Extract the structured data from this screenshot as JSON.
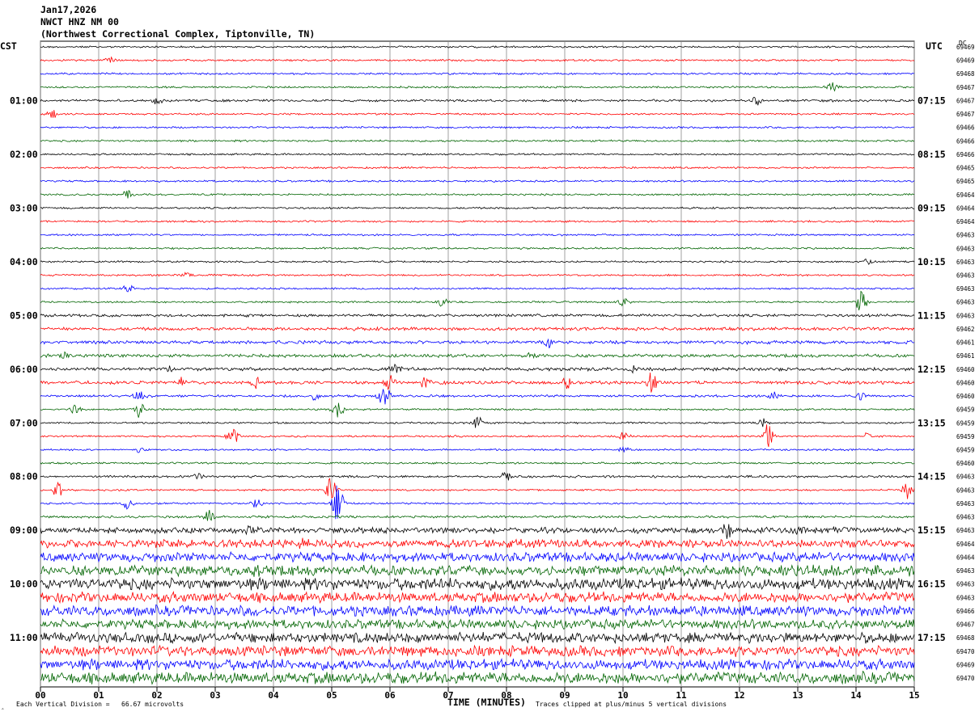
{
  "header": {
    "date": "Jan17,2026",
    "channel": "NWCT HNZ NM 00",
    "station": "(Northwest Correctional Complex, Tiptonville, TN)"
  },
  "left_tz": "CST",
  "right_tz": "UTC",
  "dc_label": "DC",
  "x_axis_label": "TIME (MINUTES)",
  "footer_left": "Each Vertical Division =   66.67 microvolts",
  "footer_right": "Traces clipped at plus/minus 5 vertical divisions",
  "colors": {
    "trace_cycle": [
      "#000000",
      "#ff0000",
      "#0000ff",
      "#006400"
    ]
  },
  "chart_data": {
    "type": "line",
    "title": "NWCT HNZ NM 00",
    "xlabel": "TIME (MINUTES)",
    "ylabel": "",
    "xlim": [
      0,
      15
    ],
    "x_ticks": [
      "00",
      "01",
      "02",
      "03",
      "04",
      "05",
      "06",
      "07",
      "08",
      "09",
      "10",
      "11",
      "12",
      "13",
      "14",
      "15"
    ],
    "grid": true,
    "rows_per_hour": 4,
    "left_hour_labels": [
      "01:00",
      "02:00",
      "03:00",
      "04:00",
      "05:00",
      "06:00",
      "07:00",
      "08:00",
      "09:00",
      "10:00",
      "11:00"
    ],
    "right_hour_labels": [
      "07:15",
      "08:15",
      "09:15",
      "10:15",
      "11:15",
      "12:15",
      "13:15",
      "14:15",
      "15:15",
      "16:15",
      "17:15"
    ],
    "dc_offsets": [
      69469,
      69469,
      69468,
      69467,
      69467,
      69467,
      69466,
      69466,
      69466,
      69465,
      69465,
      69464,
      69464,
      69464,
      69463,
      69463,
      69463,
      69463,
      69463,
      69463,
      69463,
      69462,
      69461,
      69461,
      69460,
      69460,
      69460,
      69459,
      69459,
      69459,
      69459,
      69460,
      69463,
      69463,
      69463,
      69463,
      69463,
      69464,
      69464,
      69463,
      69463,
      69463,
      69466,
      69467,
      69468,
      69470,
      69469,
      69470
    ],
    "noise_level": [
      0.08,
      0.08,
      0.08,
      0.08,
      0.1,
      0.08,
      0.08,
      0.08,
      0.08,
      0.08,
      0.08,
      0.08,
      0.08,
      0.08,
      0.08,
      0.08,
      0.08,
      0.08,
      0.08,
      0.08,
      0.12,
      0.14,
      0.14,
      0.14,
      0.14,
      0.14,
      0.1,
      0.08,
      0.08,
      0.08,
      0.08,
      0.08,
      0.1,
      0.08,
      0.08,
      0.1,
      0.25,
      0.35,
      0.4,
      0.45,
      0.5,
      0.45,
      0.45,
      0.4,
      0.45,
      0.45,
      0.45,
      0.5
    ],
    "events": [
      {
        "row": 1,
        "t": 1.2,
        "amp": 0.25
      },
      {
        "row": 4,
        "t": 12.3,
        "amp": 0.35
      },
      {
        "row": 4,
        "t": 2.0,
        "amp": 0.3
      },
      {
        "row": 5,
        "t": 0.2,
        "amp": 0.4
      },
      {
        "row": 3,
        "t": 13.6,
        "amp": 0.35
      },
      {
        "row": 11,
        "t": 1.5,
        "amp": 0.3
      },
      {
        "row": 16,
        "t": 14.2,
        "amp": 0.3
      },
      {
        "row": 17,
        "t": 2.5,
        "amp": 0.25
      },
      {
        "row": 18,
        "t": 1.5,
        "amp": 0.3
      },
      {
        "row": 19,
        "t": 14.1,
        "amp": 1.1
      },
      {
        "row": 19,
        "t": 6.9,
        "amp": 0.3
      },
      {
        "row": 19,
        "t": 10.0,
        "amp": 0.3
      },
      {
        "row": 22,
        "t": 8.7,
        "amp": 0.55
      },
      {
        "row": 23,
        "t": 8.4,
        "amp": 0.4
      },
      {
        "row": 23,
        "t": 0.4,
        "amp": 0.3
      },
      {
        "row": 24,
        "t": 6.1,
        "amp": 0.5
      },
      {
        "row": 24,
        "t": 10.2,
        "amp": 0.35
      },
      {
        "row": 24,
        "t": 2.2,
        "amp": 0.3
      },
      {
        "row": 25,
        "t": 2.4,
        "amp": 0.5
      },
      {
        "row": 25,
        "t": 3.7,
        "amp": 0.4
      },
      {
        "row": 25,
        "t": 6.0,
        "amp": 0.7
      },
      {
        "row": 25,
        "t": 9.0,
        "amp": 0.6
      },
      {
        "row": 25,
        "t": 10.5,
        "amp": 0.8
      },
      {
        "row": 25,
        "t": 6.6,
        "amp": 0.4
      },
      {
        "row": 26,
        "t": 1.7,
        "amp": 0.5
      },
      {
        "row": 26,
        "t": 5.9,
        "amp": 0.9
      },
      {
        "row": 26,
        "t": 4.7,
        "amp": 0.4
      },
      {
        "row": 26,
        "t": 12.6,
        "amp": 0.4
      },
      {
        "row": 26,
        "t": 14.1,
        "amp": 0.35
      },
      {
        "row": 27,
        "t": 1.7,
        "amp": 0.6
      },
      {
        "row": 27,
        "t": 5.1,
        "amp": 0.7
      },
      {
        "row": 27,
        "t": 0.6,
        "amp": 0.3
      },
      {
        "row": 28,
        "t": 7.5,
        "amp": 0.5
      },
      {
        "row": 28,
        "t": 12.4,
        "amp": 0.35
      },
      {
        "row": 29,
        "t": 3.3,
        "amp": 0.8
      },
      {
        "row": 29,
        "t": 12.5,
        "amp": 1.0
      },
      {
        "row": 29,
        "t": 10.0,
        "amp": 0.35
      },
      {
        "row": 29,
        "t": 14.2,
        "amp": 0.3
      },
      {
        "row": 30,
        "t": 1.7,
        "amp": 0.25
      },
      {
        "row": 30,
        "t": 10.0,
        "amp": 0.25
      },
      {
        "row": 32,
        "t": 2.7,
        "amp": 0.35
      },
      {
        "row": 32,
        "t": 8.0,
        "amp": 0.35
      },
      {
        "row": 33,
        "t": 0.3,
        "amp": 0.6
      },
      {
        "row": 33,
        "t": 5.0,
        "amp": 1.0
      },
      {
        "row": 33,
        "t": 14.9,
        "amp": 0.7
      },
      {
        "row": 34,
        "t": 5.1,
        "amp": 1.8
      },
      {
        "row": 34,
        "t": 1.5,
        "amp": 0.5
      },
      {
        "row": 34,
        "t": 3.7,
        "amp": 0.35
      },
      {
        "row": 35,
        "t": 2.9,
        "amp": 0.5
      },
      {
        "row": 36,
        "t": 3.6,
        "amp": 0.55
      },
      {
        "row": 36,
        "t": 11.8,
        "amp": 0.6
      },
      {
        "row": 36,
        "t": 13.0,
        "amp": 0.45
      },
      {
        "row": 37,
        "t": 4.5,
        "amp": 0.3
      },
      {
        "row": 39,
        "t": 3.7,
        "amp": 0.45
      },
      {
        "row": 39,
        "t": 13.3,
        "amp": 0.35
      }
    ]
  }
}
